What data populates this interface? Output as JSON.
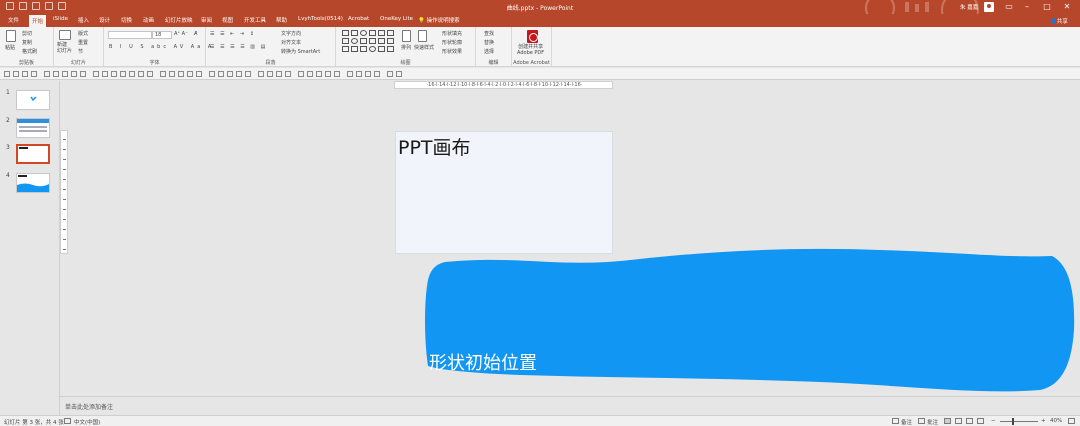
{
  "titlebar": {
    "doc_title": "曲线.pptx - PowerPoint",
    "user_name": "朱 嘉嘉",
    "share_label": "共享"
  },
  "tabs": [
    "文件",
    "开始",
    "iSlide",
    "插入",
    "设计",
    "切换",
    "动画",
    "幻灯片放映",
    "审阅",
    "视图",
    "开发工具",
    "帮助",
    "LvyhTools(0514)",
    "Acrobat",
    "OneKey Lite",
    "操作说明搜索"
  ],
  "active_tab_index": 1,
  "ribbon": {
    "clipboard": {
      "label": "剪贴板",
      "paste": "粘贴",
      "cut": "剪切",
      "copy": "复制",
      "format_painter": "格式刷"
    },
    "slides": {
      "label": "幻灯片",
      "new_slide": "新建\n幻灯片",
      "layout": "版式",
      "reset": "重置",
      "section": "节"
    },
    "font": {
      "label": "字体",
      "font_size": "18"
    },
    "paragraph": {
      "label": "段落",
      "text_direction": "文字方向",
      "align_text": "对齐文本",
      "smartart": "转换为 SmartArt"
    },
    "drawing": {
      "label": "绘图",
      "arrange": "排列",
      "quick_styles": "快速样式",
      "shape_fill": "形状填充",
      "shape_outline": "形状轮廓",
      "shape_effects": "形状效果"
    },
    "editing": {
      "label": "编辑",
      "find": "查找",
      "replace": "替换",
      "select": "选择"
    },
    "acrobat": {
      "label": "Adobe Acrobat",
      "create_pdf": "创建并共享\nAdobe PDF"
    }
  },
  "ruler_text": "·16·l·14·l·12·l·10·l·8·l·6·l·4·l·2·l·0·l·2·l·4·l·6·l·8·l·10·l·12·l·14·l·16·",
  "thumbnails": [
    {
      "num": "1"
    },
    {
      "num": "2"
    },
    {
      "num": "3",
      "active": true
    },
    {
      "num": "4"
    }
  ],
  "slide": {
    "title": "PPT画布"
  },
  "shape": {
    "label": "形状初始位置",
    "fill": "#1296f3"
  },
  "notes_placeholder": "单击此处添加备注",
  "statusbar": {
    "slide_info": "幻灯片 第 3 张，共 4 张",
    "language": "中文(中国)",
    "notes": "备注",
    "comments": "批注",
    "zoom": "40%"
  },
  "colors": {
    "accent": "#b7472a",
    "canvas": "#e6e6e6",
    "slide_bg": "#f1f4fa"
  }
}
